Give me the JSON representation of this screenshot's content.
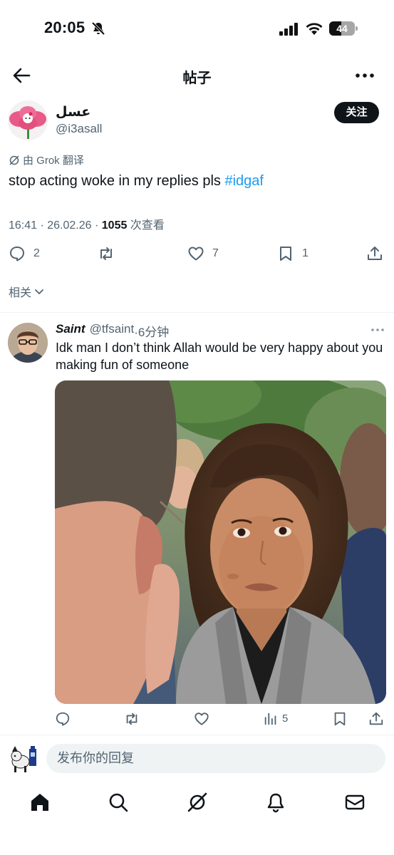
{
  "status_bar": {
    "time": "20:05",
    "battery": "44"
  },
  "header": {
    "title": "帖子"
  },
  "post": {
    "display_name": "عسل",
    "handle": "@i3asall",
    "follow_label": "关注",
    "translated_by": "由 Grok 翻译",
    "text": "stop acting woke in my replies pls",
    "hashtag": "#idgaf",
    "time": "16:41 · 26.02.26 · ",
    "views": "1055",
    "views_label": " 次查看",
    "replies": "2",
    "likes": "7",
    "bookmarks": "1"
  },
  "related_label": "相关",
  "reply": {
    "name": "Saint",
    "handle": "@tfsaint",
    "time": "·6分钟",
    "text": "Idk man I don’t think Allah would be very happy about you making fun of someone",
    "views": "5"
  },
  "composer": {
    "placeholder": "发布你的回复"
  },
  "icons": {
    "nav": [
      "home-icon",
      "search-icon",
      "grok-icon",
      "bell-icon",
      "mail-icon"
    ]
  },
  "colors": {
    "accent": "#1d9bf0",
    "text": "#0f1419",
    "muted": "#536471"
  }
}
